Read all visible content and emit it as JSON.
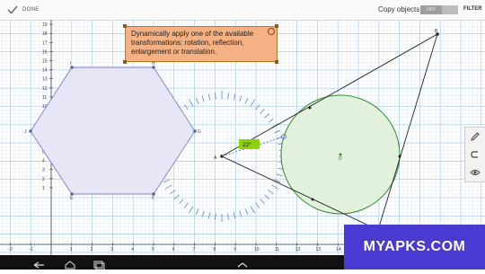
{
  "topbar": {
    "done_label": "DONE",
    "copy_objects_label": "Copy objects",
    "copy_toggle_state": "OFF",
    "filter_label": "FILTER"
  },
  "tooltip": {
    "text": "Dynamically apply one of the available transformations: rotation, reflection, enlargement or translation."
  },
  "axes": {
    "x_ticks": [
      "-2",
      "-1",
      "1",
      "2",
      "3",
      "4",
      "5",
      "6",
      "7",
      "8",
      "9",
      "10",
      "11",
      "12",
      "13",
      "14"
    ],
    "y_ticks": [
      "20",
      "19",
      "18",
      "17",
      "16",
      "15",
      "14",
      "13",
      "12",
      "11",
      "10",
      "9",
      "8",
      "7",
      "6",
      "5",
      "4",
      "3",
      "2",
      "1"
    ]
  },
  "points": {
    "hex_i": "I",
    "hex_h": "H",
    "hex_j": "J",
    "hex_g": "G",
    "hex_e": "E",
    "hex_f": "F",
    "pt_a": "A",
    "pt_b": "B",
    "pt_c": "C",
    "pt_d": "D"
  },
  "angle_label": "22°",
  "toolbox": [
    "pencil-icon",
    "undo-icon",
    "eye-icon"
  ],
  "watermark": "MYAPKS.COM",
  "colors": {
    "hexagon_fill": "#e6e6f7",
    "hexagon_stroke": "#7f7fd1",
    "circle_fill": "#e2f1dc",
    "circle_stroke": "#2f8a2f",
    "grid_major": "#9ec6ee",
    "grid_minor": "#dbe9f8",
    "tooltip_bg": "#f4b183",
    "angle_badge": "#8bd400",
    "protractor": "#4a6fcf",
    "watermark_bg": "#4b3ad1"
  }
}
